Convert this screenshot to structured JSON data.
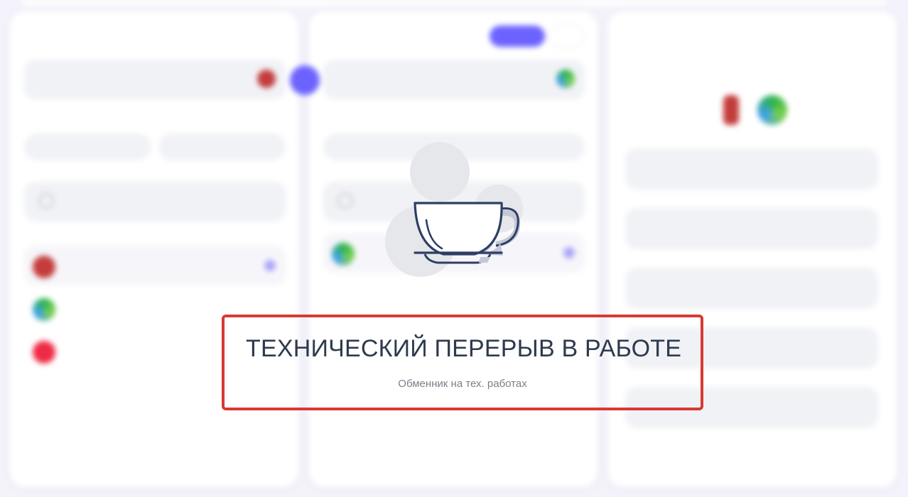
{
  "maintenance": {
    "title": "ТЕХНИЧЕСКИЙ ПЕРЕРЫВ В РАБОТЕ",
    "subtitle": "Обменник на тех. работах",
    "icon": "coffee-cup-icon"
  },
  "colors": {
    "accent": "#6c63ff",
    "highlight_border": "#d73a32",
    "title_text": "#2e3a4d",
    "background": "#f4f3fb"
  }
}
